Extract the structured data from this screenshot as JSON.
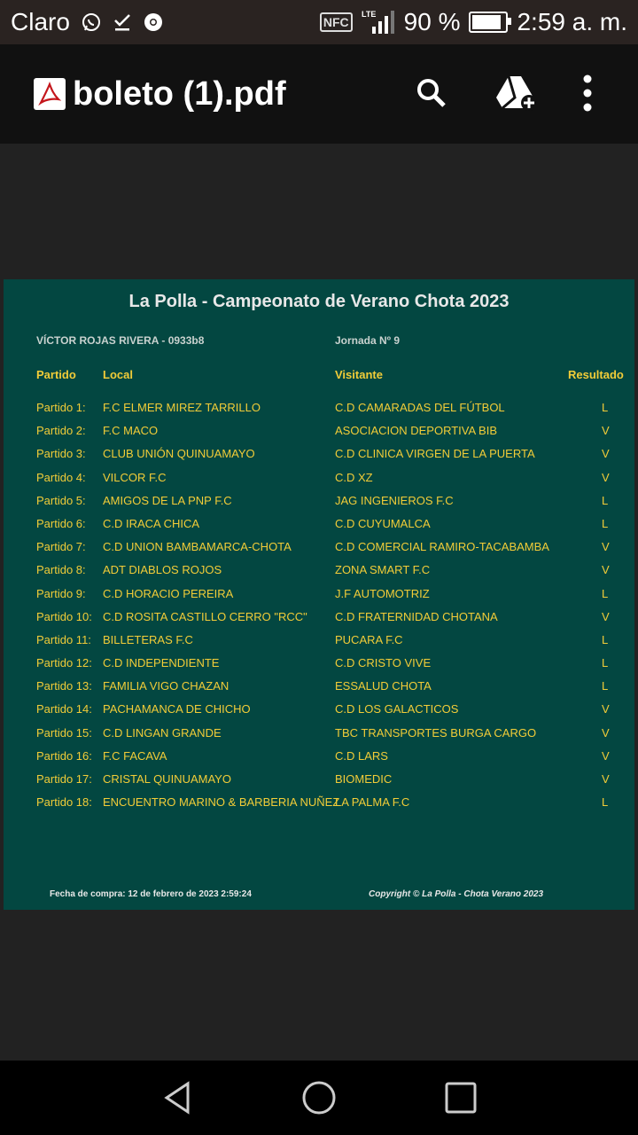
{
  "status_bar": {
    "carrier": "Claro",
    "nfc_label": "NFC",
    "network_label": "LTE",
    "battery": "90 %",
    "battery_level": 0.9,
    "time": "2:59 a. m."
  },
  "app_bar": {
    "file_name": "boleto (1).pdf",
    "icons": [
      "pdf-icon",
      "search-icon",
      "drive-add-icon",
      "more-vert-icon"
    ]
  },
  "document": {
    "title": "La Polla - Campeonato de Verano Chota 2023",
    "player": "VÍCTOR ROJAS RIVERA - 0933b8",
    "jornada": "Jornada Nº 9",
    "headers": {
      "partido": "Partido",
      "local": "Local",
      "visitante": "Visitante",
      "resultado": "Resultado"
    },
    "matches": [
      {
        "num": "Partido 1:",
        "local": "F.C ELMER MIREZ TARRILLO",
        "visitante": "C.D CAMARADAS DEL FÚTBOL",
        "resultado": "L"
      },
      {
        "num": "Partido 2:",
        "local": "F.C MACO",
        "visitante": "ASOCIACION DEPORTIVA BIB",
        "resultado": "V"
      },
      {
        "num": "Partido 3:",
        "local": "CLUB UNIÓN QUINUAMAYO",
        "visitante": "C.D CLINICA VIRGEN DE LA PUERTA",
        "resultado": "V"
      },
      {
        "num": "Partido 4:",
        "local": "VILCOR F.C",
        "visitante": "C.D XZ",
        "resultado": "V"
      },
      {
        "num": "Partido 5:",
        "local": "AMIGOS DE LA PNP F.C",
        "visitante": "JAG INGENIEROS F.C",
        "resultado": "L"
      },
      {
        "num": "Partido 6:",
        "local": "C.D IRACA CHICA",
        "visitante": "C.D CUYUMALCA",
        "resultado": "L"
      },
      {
        "num": "Partido 7:",
        "local": "C.D UNION BAMBAMARCA-CHOTA",
        "visitante": "C.D COMERCIAL RAMIRO-TACABAMBA",
        "resultado": "V"
      },
      {
        "num": "Partido 8:",
        "local": "ADT DIABLOS ROJOS",
        "visitante": "ZONA SMART F.C",
        "resultado": "V"
      },
      {
        "num": "Partido 9:",
        "local": "C.D HORACIO PEREIRA",
        "visitante": "J.F AUTOMOTRIZ",
        "resultado": "L"
      },
      {
        "num": "Partido 10:",
        "local": "C.D ROSITA CASTILLO CERRO \"RCC\"",
        "visitante": "C.D FRATERNIDAD CHOTANA",
        "resultado": "V"
      },
      {
        "num": "Partido 11:",
        "local": "BILLETERAS F.C",
        "visitante": "PUCARA F.C",
        "resultado": "L"
      },
      {
        "num": "Partido 12:",
        "local": "C.D INDEPENDIENTE",
        "visitante": "C.D CRISTO VIVE",
        "resultado": "L"
      },
      {
        "num": "Partido 13:",
        "local": "FAMILIA VIGO CHAZAN",
        "visitante": "ESSALUD CHOTA",
        "resultado": "L"
      },
      {
        "num": "Partido 14:",
        "local": "PACHAMANCA DE CHICHO",
        "visitante": "C.D LOS GALACTICOS",
        "resultado": "V"
      },
      {
        "num": "Partido 15:",
        "local": "C.D LINGAN GRANDE",
        "visitante": "TBC TRANSPORTES BURGA CARGO",
        "resultado": "V"
      },
      {
        "num": "Partido 16:",
        "local": "F.C FACAVA",
        "visitante": "C.D LARS",
        "resultado": "V"
      },
      {
        "num": "Partido 17:",
        "local": "CRISTAL QUINUAMAYO",
        "visitante": "BIOMEDIC",
        "resultado": "V"
      },
      {
        "num": "Partido 18:",
        "local": "ENCUENTRO MARINO & BARBERIA NUÑEZ",
        "visitante": "LA PALMA F.C",
        "resultado": "L"
      }
    ],
    "footer_left": "Fecha de compra: 12 de febrero de 2023 2:59:24",
    "footer_right": "Copyright © La Polla - Chota Verano 2023"
  },
  "nav_bar": {
    "icons": [
      "back-icon",
      "home-icon",
      "recents-icon"
    ]
  },
  "colors": {
    "page_bg": "#034741",
    "text_yellow": "#f2cc38",
    "viewer_bg": "#222222"
  }
}
